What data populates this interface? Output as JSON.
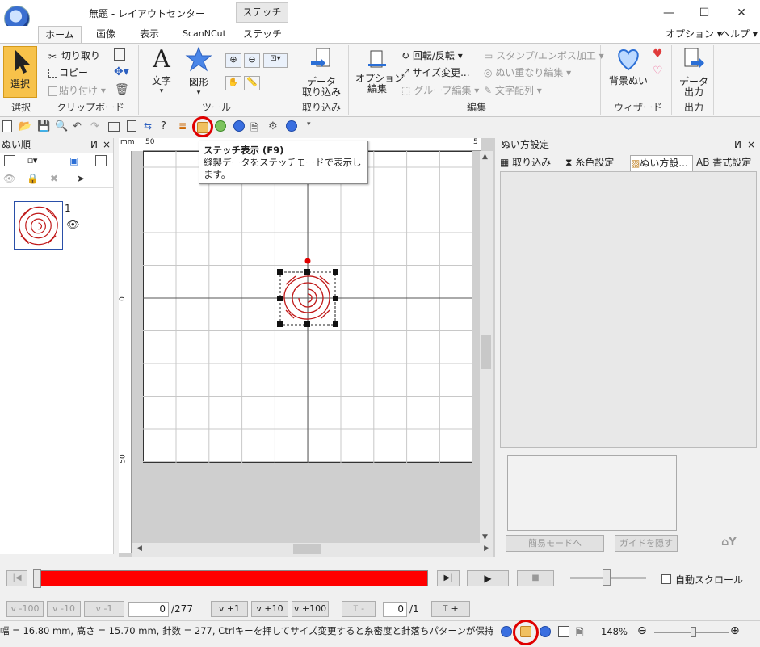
{
  "window": {
    "title": "無題 - レイアウトセンター",
    "contextual_tab": "ステッチ",
    "minimize": "—",
    "maximize": "☐",
    "close": "✕"
  },
  "tabs": [
    "ホーム",
    "画像",
    "表示",
    "ScanNCut",
    "ステッチ"
  ],
  "header_right": {
    "options": "オプション",
    "help": "ヘルプ"
  },
  "ribbon": {
    "select": {
      "label": "選択",
      "group": "選択"
    },
    "clipboard": {
      "cut": "切り取り",
      "copy": "コピー",
      "paste": "貼り付け",
      "group": "クリップボード"
    },
    "tools": {
      "text": "文字",
      "shape": "図形",
      "group": "ツール"
    },
    "import": {
      "data_import": "データ\n取り込み",
      "group": "取り込み"
    },
    "edit": {
      "option_edit": "オプション\n編集",
      "rotate_flip": "回転/反転",
      "resize": "サイズ変更...",
      "group_edit": "グループ編集",
      "stamp_emboss": "スタンプ/エンボス加工",
      "overlap": "ぬい重なり編集",
      "text_arrange": "文字配列",
      "group": "編集"
    },
    "wizard": {
      "bg_sew": "背景ぬい",
      "group": "ウィザード"
    },
    "output": {
      "data_output": "データ\n出力",
      "group": "出力"
    }
  },
  "tooltip": {
    "title": "ステッチ表示 (F9)",
    "body": "縫製データをステッチモードで表示します。"
  },
  "left_panel": {
    "title": "ぬい順",
    "pin": "ㅁ",
    "close": "×",
    "item_number": "1"
  },
  "canvas": {
    "unit": "mm",
    "ruler_top_left": "50",
    "ruler_top_right": "5",
    "ruler_left_mid": "0",
    "ruler_left_bottom": "50"
  },
  "right_panel": {
    "title": "ぬい方設定",
    "tabs": [
      "取り込み",
      "糸色設定",
      "ぬい方設...",
      "AB 書式設定"
    ],
    "simple_mode": "簡易モードへ",
    "hide_guide": "ガイドを隠す"
  },
  "playback": {
    "auto_scroll": "自動スクロール",
    "progress_fraction": 1.0,
    "bar_color": "#ff0000"
  },
  "step": {
    "minus100": "-100",
    "minus10": "-10",
    "minus1": "-1",
    "current": "0",
    "total": "/277",
    "plus1": "+1",
    "plus10": "+10",
    "plus100": "+100",
    "color_current": "0",
    "color_total": "/1",
    "color_minus": "-",
    "color_plus": "+"
  },
  "status": {
    "text": "幅 = 16.80 mm, 高さ = 15.70 mm, 針数 = 277, Ctrlキーを押してサイズ変更すると糸密度と針落ちパターンが保持されま...",
    "zoom": "148%"
  },
  "colors": {
    "accent": "#e00000",
    "select_btn": "#f7c24a",
    "rose": "#c01818"
  }
}
